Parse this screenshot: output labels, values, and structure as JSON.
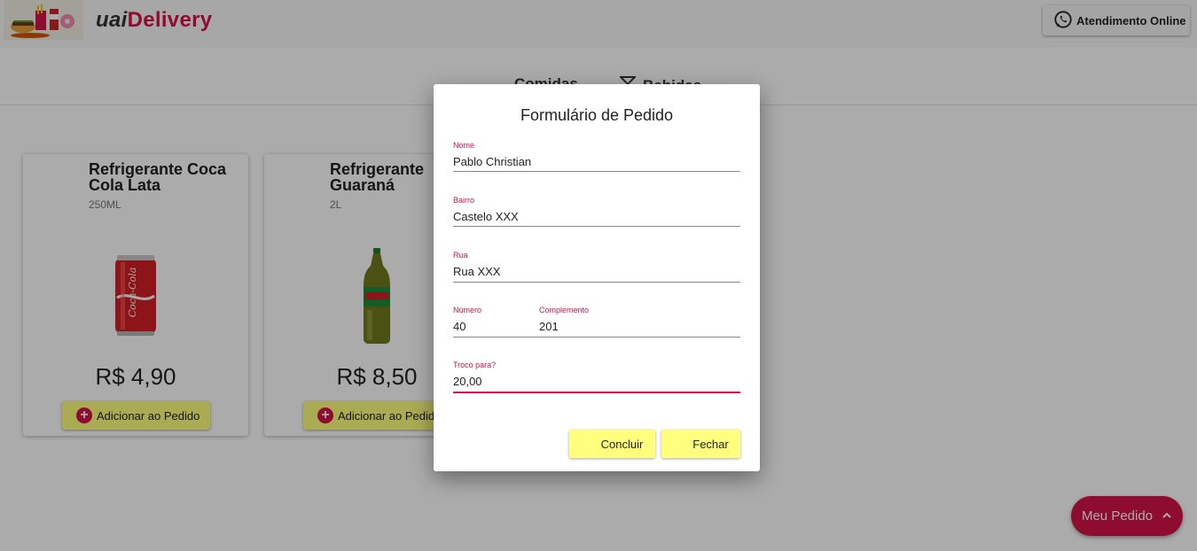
{
  "header": {
    "brand_prefix": "uai",
    "brand_suffix": "Delivery",
    "support_label": "Atendimento Online",
    "support_icon": "whatsapp-icon"
  },
  "tabs": [
    {
      "label": "Comidas",
      "icon": "none"
    },
    {
      "label": "Bebidas",
      "icon": "cocktail-icon"
    }
  ],
  "products": [
    {
      "name": "Refrigerante Coca Cola Lata",
      "volume": "250ML",
      "price": "R$ 4,90",
      "add_label": "Adicionar ao Pedido"
    },
    {
      "name": "Refrigerante Guaraná",
      "volume": "2L",
      "price": "R$ 8,50",
      "add_label": "Adicionar ao Pedido"
    }
  ],
  "fab": {
    "label": "Meu Pedido"
  },
  "modal": {
    "title": "Formulário de Pedido",
    "fields": {
      "nome": {
        "label": "Nome",
        "value": "Pablo Christian"
      },
      "bairro": {
        "label": "Bairro",
        "value": "Castelo XXX"
      },
      "rua": {
        "label": "Rua",
        "value": "Rua XXX"
      },
      "numero": {
        "label": "Número",
        "value": "40"
      },
      "complemento": {
        "label": "Complemento",
        "value": "201"
      },
      "troco": {
        "label": "Troco para?",
        "value": "20,00"
      }
    },
    "confirm_label": "Concluir",
    "close_label": "Fechar"
  },
  "colors": {
    "accent": "#d5134a",
    "button": "#ffff7e"
  }
}
